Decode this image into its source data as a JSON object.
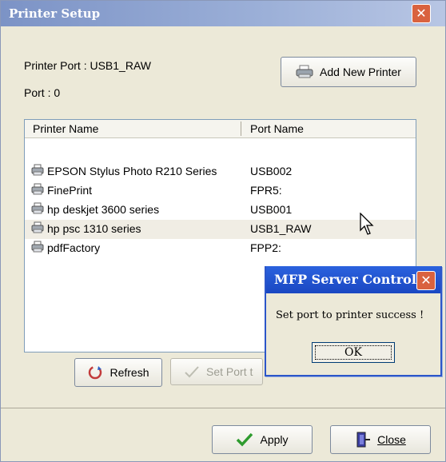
{
  "window": {
    "title": "Printer Setup"
  },
  "info": {
    "printer_port": "Printer Port : USB1_RAW",
    "port": "Port : 0"
  },
  "buttons": {
    "add_new_printer": "Add New Printer",
    "refresh": "Refresh",
    "set_port": "Set Port t",
    "apply": "Apply",
    "close": "Close"
  },
  "table": {
    "columns": [
      "Printer Name",
      "Port Name"
    ],
    "rows": [
      {
        "name": "EPSON Stylus Photo R210 Series",
        "port": "USB002"
      },
      {
        "name": "FinePrint",
        "port": "FPR5:"
      },
      {
        "name": "hp deskjet 3600 series",
        "port": "USB001"
      },
      {
        "name": "hp psc 1310 series",
        "port": "USB1_RAW"
      },
      {
        "name": "pdfFactory",
        "port": "FPP2:"
      }
    ],
    "selected_index": 3
  },
  "message_box": {
    "title": "MFP Server Control...",
    "message": "Set port to printer success !",
    "ok_label": "OK"
  },
  "icons": {
    "printer": "printer-icon",
    "close": "close-icon",
    "refresh": "refresh-icon",
    "apply": "checkmark-icon",
    "exit": "exit-door-icon",
    "cursor": "mouse-pointer-icon"
  }
}
